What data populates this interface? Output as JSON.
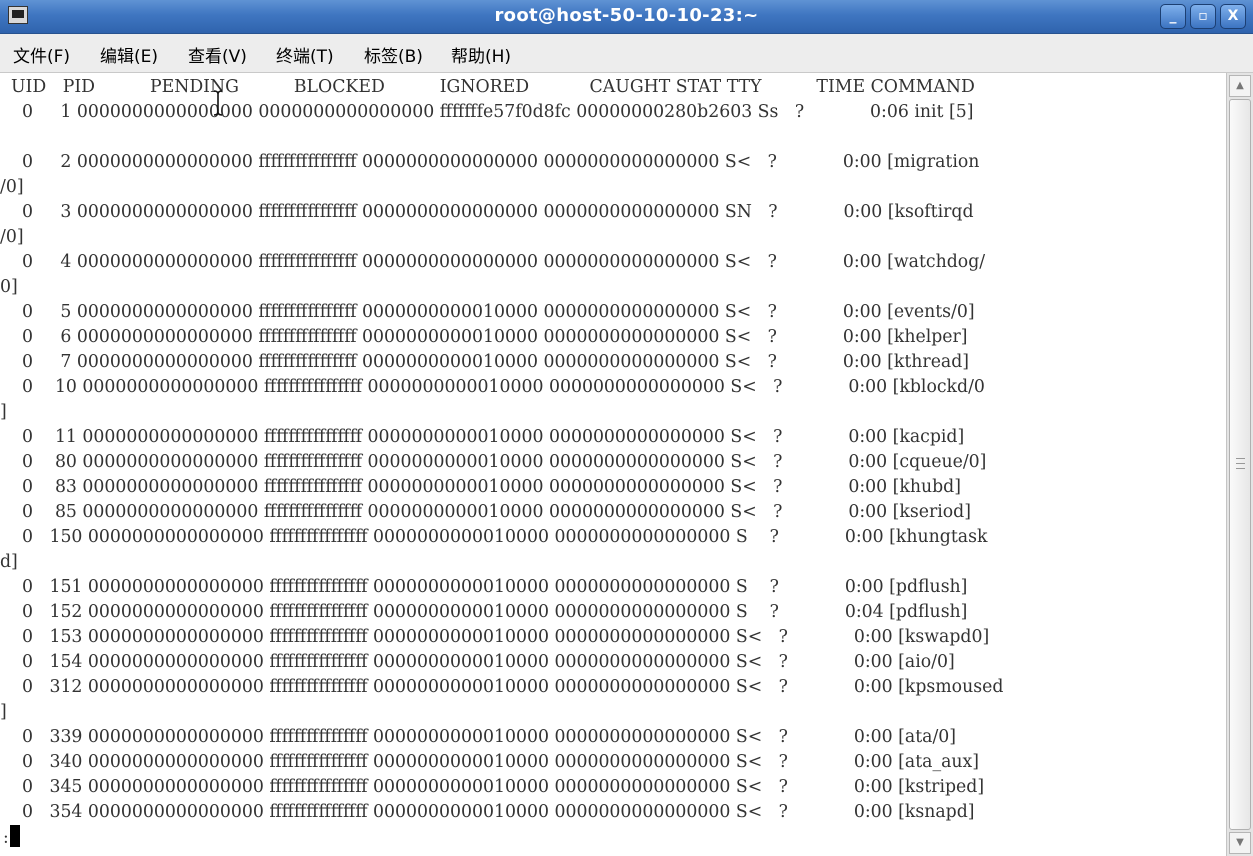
{
  "window": {
    "title": "root@host-50-10-10-23:~",
    "buttons": {
      "minimize": "_",
      "maximize": "▫",
      "close": "X"
    }
  },
  "menubar": {
    "items": [
      "文件(F)",
      "编辑(E)",
      "查看(V)",
      "终端(T)",
      "标签(B)",
      "帮助(H)"
    ]
  },
  "terminal": {
    "lines": [
      "  UID   PID          PENDING          BLOCKED          IGNORED           CAUGHT STAT TTY          TIME COMMAND",
      "    0     1 0000000000000000 0000000000000000 fffffffe57f0d8fc 00000000280b2603 Ss   ?            0:06 init [5]",
      "",
      "    0     2 0000000000000000 ffffffffffffffff 0000000000000000 0000000000000000 S<   ?            0:00 [migration",
      "/0]",
      "    0     3 0000000000000000 ffffffffffffffff 0000000000000000 0000000000000000 SN   ?            0:00 [ksoftirqd",
      "/0]",
      "    0     4 0000000000000000 ffffffffffffffff 0000000000000000 0000000000000000 S<   ?            0:00 [watchdog/",
      "0]",
      "    0     5 0000000000000000 ffffffffffffffff 0000000000010000 0000000000000000 S<   ?            0:00 [events/0]",
      "    0     6 0000000000000000 ffffffffffffffff 0000000000010000 0000000000000000 S<   ?            0:00 [khelper]",
      "    0     7 0000000000000000 ffffffffffffffff 0000000000010000 0000000000000000 S<   ?            0:00 [kthread]",
      "    0    10 0000000000000000 ffffffffffffffff 0000000000010000 0000000000000000 S<   ?            0:00 [kblockd/0",
      "]",
      "    0    11 0000000000000000 ffffffffffffffff 0000000000010000 0000000000000000 S<   ?            0:00 [kacpid]",
      "    0    80 0000000000000000 ffffffffffffffff 0000000000010000 0000000000000000 S<   ?            0:00 [cqueue/0]",
      "    0    83 0000000000000000 ffffffffffffffff 0000000000010000 0000000000000000 S<   ?            0:00 [khubd]",
      "    0    85 0000000000000000 ffffffffffffffff 0000000000010000 0000000000000000 S<   ?            0:00 [kseriod]",
      "    0   150 0000000000000000 ffffffffffffffff 0000000000010000 0000000000000000 S    ?            0:00 [khungtask",
      "d]",
      "    0   151 0000000000000000 ffffffffffffffff 0000000000010000 0000000000000000 S    ?            0:00 [pdflush]",
      "    0   152 0000000000000000 ffffffffffffffff 0000000000010000 0000000000000000 S    ?            0:04 [pdflush]",
      "    0   153 0000000000000000 ffffffffffffffff 0000000000010000 0000000000000000 S<   ?            0:00 [kswapd0]",
      "    0   154 0000000000000000 ffffffffffffffff 0000000000010000 0000000000000000 S<   ?            0:00 [aio/0]",
      "    0   312 0000000000000000 ffffffffffffffff 0000000000010000 0000000000000000 S<   ?            0:00 [kpsmoused",
      "]",
      "    0   339 0000000000000000 ffffffffffffffff 0000000000010000 0000000000000000 S<   ?            0:00 [ata/0]",
      "    0   340 0000000000000000 ffffffffffffffff 0000000000010000 0000000000000000 S<   ?            0:00 [ata_aux]",
      "    0   345 0000000000000000 ffffffffffffffff 0000000000010000 0000000000000000 S<   ?            0:00 [kstriped]",
      "    0   354 0000000000000000 ffffffffffffffff 0000000000010000 0000000000000000 S<   ?            0:00 [ksnapd]"
    ],
    "prompt": ":"
  },
  "icons": {
    "window_icon": "terminal-window-icon",
    "cursor": "text-ibeam-cursor-icon",
    "scroll_up": "scroll-up-arrow-icon",
    "scroll_down": "scroll-down-arrow-icon"
  },
  "colors": {
    "titlebar": "#3f76c1",
    "menubar": "#ededed",
    "terminal_bg": "#ffffff",
    "terminal_text": "#333333"
  }
}
